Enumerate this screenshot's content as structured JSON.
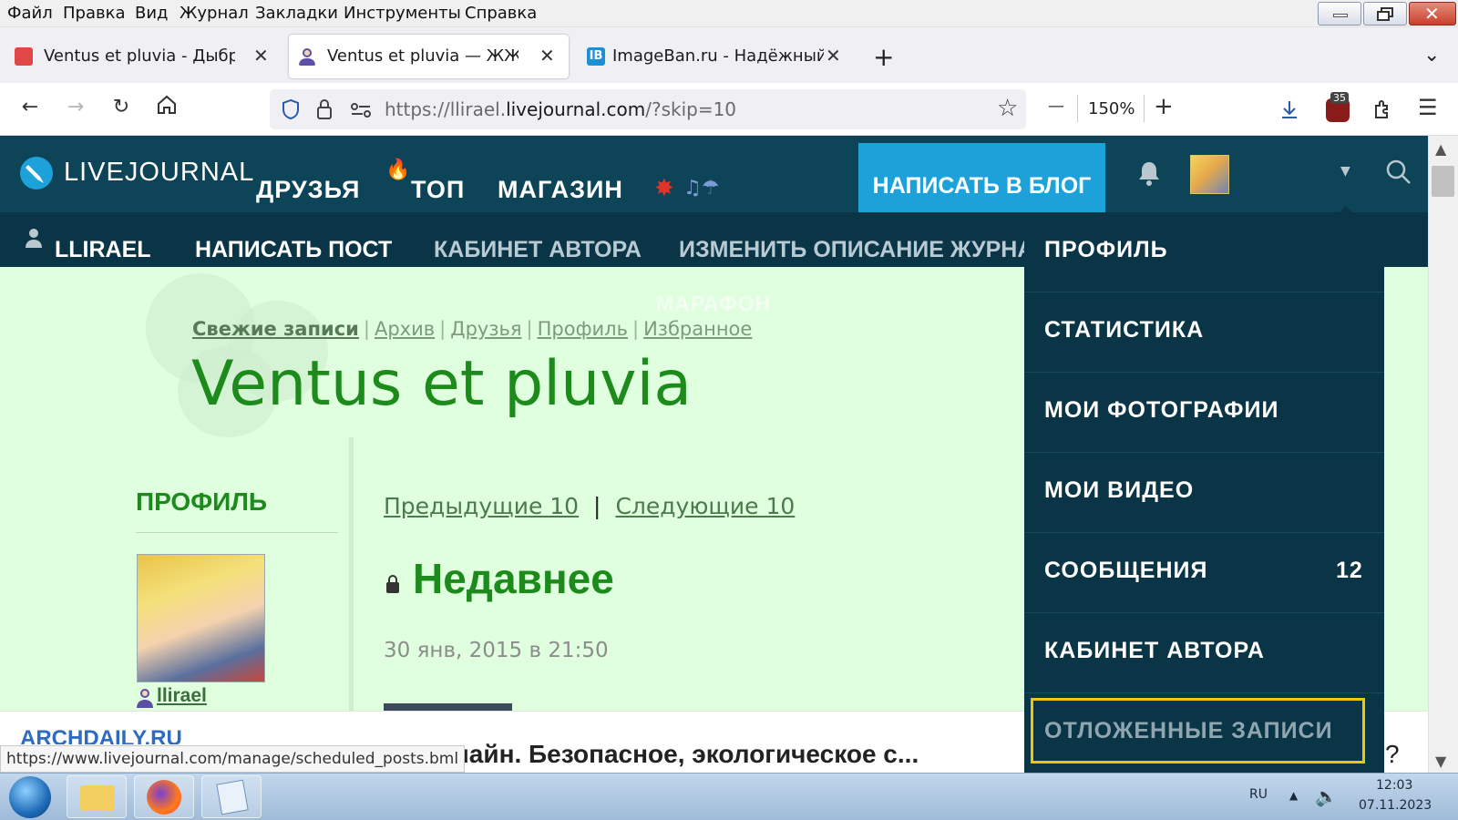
{
  "menu": [
    "Файл",
    "Правка",
    "Вид",
    "Журнал",
    "Закладки",
    "Инструменты",
    "Справка"
  ],
  "tabs": [
    {
      "title": "Ventus et pluvia - Дыбр",
      "close": "✕"
    },
    {
      "title": "Ventus et pluvia — ЖЖ",
      "close": "✕"
    },
    {
      "title": "ImageBan.ru - Надёжный ф",
      "close": "✕"
    }
  ],
  "new_tab": "+",
  "tab_overflow": "⌄",
  "url": {
    "prefix": "https://llirael.",
    "domain": "livejournal.com",
    "path": "/?skip=10"
  },
  "zoom": {
    "minus": "—",
    "value": "150%",
    "plus": "+"
  },
  "extension_badge": "35",
  "lj": {
    "logo": "LIVEJOURNAL",
    "nav": [
      "ДРУЗЬЯ",
      "ТОП",
      "МАГАЗИН"
    ],
    "write_button": "НАПИСАТЬ В БЛОГ",
    "sub": {
      "user": "LLIRAEL",
      "write_post": "НАПИСАТЬ ПОСТ",
      "author_cabinet": "КАБИНЕТ АВТОРА",
      "edit_desc": "ИЗМЕНИТЬ ОПИСАНИЕ ЖУРНАЛА"
    },
    "marathon": "МАРАФОН"
  },
  "blog": {
    "breadcrumbs": [
      "Свежие записи",
      "Архив",
      "Друзья",
      "Профиль",
      "Избранное"
    ],
    "title": "Ventus et pluvia",
    "profile_heading": "ПРОФИЛЬ",
    "username": "llirael",
    "prev": "Предыдущие 10",
    "separator": "|",
    "next": "Следующие 10",
    "post_title": "Недавнее",
    "post_date": "30 янв, 2015 в 21:50"
  },
  "dropdown": [
    {
      "label": "ПРОФИЛЬ"
    },
    {
      "label": "СТАТИСТИКА"
    },
    {
      "label": "МОИ ФОТОГРАФИИ"
    },
    {
      "label": "МОИ ВИДЕО"
    },
    {
      "label": "СООБЩЕНИЯ",
      "count": "12"
    },
    {
      "label": "КАБИНЕТ АВТОРА"
    },
    {
      "label": "ОТЛОЖЕННЫЕ ЗАПИСИ"
    }
  ],
  "ad": {
    "brand": "ARCHDAILY.RU",
    "text": "лайн. Безопасное, экологическое с...",
    "tail": "?"
  },
  "status_url": "https://www.livejournal.com/manage/scheduled_posts.bml",
  "taskbar": {
    "lang": "RU",
    "time": "12:03",
    "date": "07.11.2023"
  },
  "colors": {
    "lj_header": "#0e4458",
    "accent": "#1da1d9",
    "highlight": "#f2c40f",
    "blog_green": "#1c8b1c"
  }
}
